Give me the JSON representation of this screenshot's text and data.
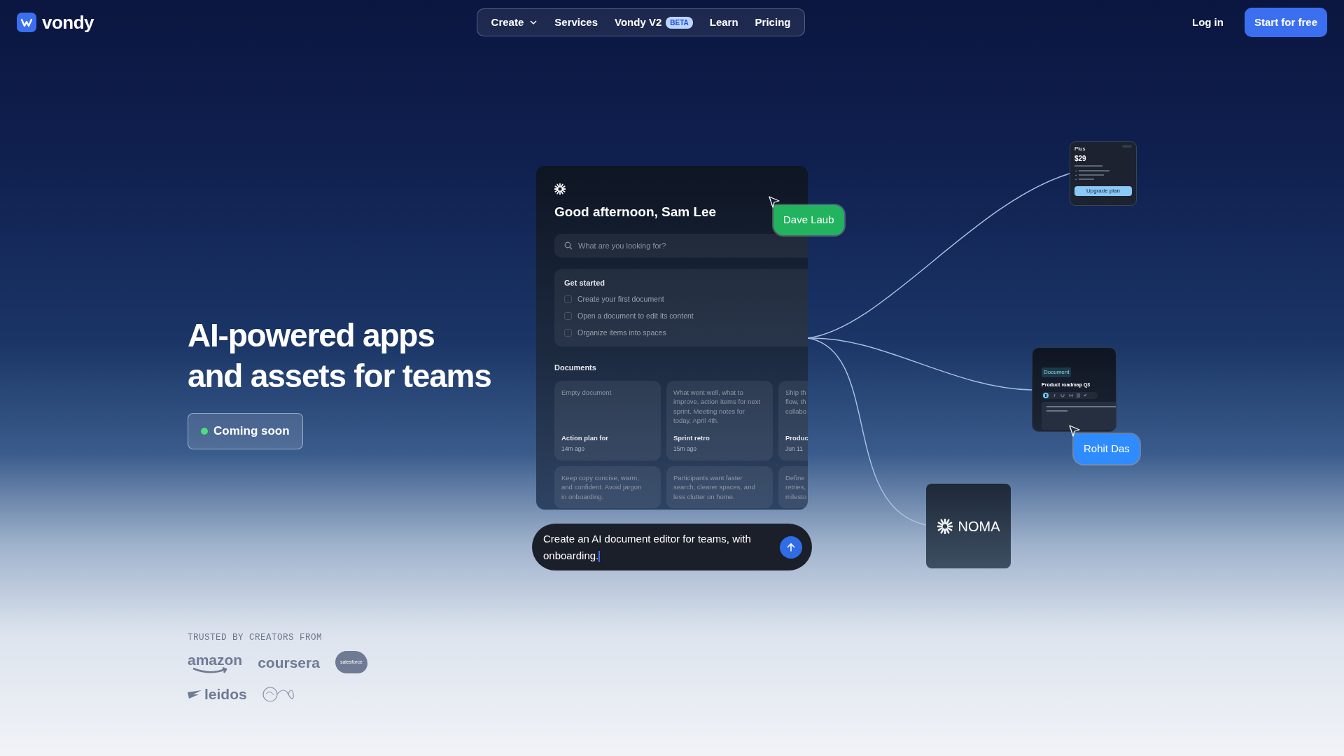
{
  "nav": {
    "logo": "vondy",
    "menu": [
      {
        "label": "Create",
        "kind": "dropdown"
      },
      {
        "label": "Services",
        "kind": "link"
      },
      {
        "label": "Vondy V2",
        "kind": "link",
        "badge": "BETA"
      },
      {
        "label": "Learn",
        "kind": "link"
      },
      {
        "label": "Pricing",
        "kind": "link"
      }
    ],
    "login": "Log in",
    "cta": "Start for free"
  },
  "hero": {
    "title_lines": [
      "AI-powered apps",
      "and assets for teams"
    ],
    "status": "Coming soon"
  },
  "app": {
    "greeting": "Good afternoon, Sam Lee",
    "search": {
      "placeholder": "What are you looking for?"
    },
    "get_started": {
      "title": "Get started",
      "tasks": [
        {
          "label": "Create your first document",
          "checked": false
        },
        {
          "label": "Open a document to edit its content",
          "checked": false
        },
        {
          "label": "Organize items into spaces",
          "checked": false
        }
      ]
    },
    "documents": {
      "title": "Documents",
      "cards": [
        {
          "preview_lines": [
            "Empty document"
          ],
          "title": "Action plan for",
          "time": "14m ago"
        },
        {
          "preview_lines": [
            "What went well, what to",
            "improve, action items for next",
            "sprint. Meeting notes for",
            "today, April 4th."
          ],
          "title": "Sprint retro",
          "time": "15m ago"
        },
        {
          "preview_lines": [
            "Ship th",
            "flow, th",
            "collabo"
          ],
          "title": "Produc",
          "time": "Jun 11"
        },
        {
          "preview_lines": [
            "Keep copy concise, warm,",
            "and confident. Avoid jargon",
            "in onboarding."
          ]
        },
        {
          "preview_lines": [
            "Participants want faster",
            "search, clearer spaces, and",
            "less clutter on home."
          ]
        },
        {
          "preview_lines": [
            "Define",
            "retries,",
            "milesto"
          ]
        }
      ]
    },
    "prompt_lines": [
      "Create an AI document editor for teams, with",
      "onboarding."
    ]
  },
  "cursors": [
    {
      "name": "Dave Laub",
      "color": "#22b35e"
    },
    {
      "name": "Rohit Das",
      "color": "#2f8cff"
    }
  ],
  "pricing_card": {
    "plan": "Plus",
    "price": "$29",
    "button": "Upgrade plan"
  },
  "roadmap_card": {
    "tag": "Document",
    "title": "Product roadmap Q3"
  },
  "noma_card": {
    "label": "NOMA"
  },
  "trusted": {
    "label": "TRUSTED BY CREATORS FROM",
    "logos": [
      {
        "text": "amazon",
        "kind": "amazon"
      },
      {
        "text": "coursera",
        "kind": "plain"
      },
      {
        "text": "salesforce",
        "kind": "cloud"
      },
      {
        "text": "leidos",
        "kind": "leidos"
      },
      {
        "kind": "virgin"
      }
    ]
  }
}
